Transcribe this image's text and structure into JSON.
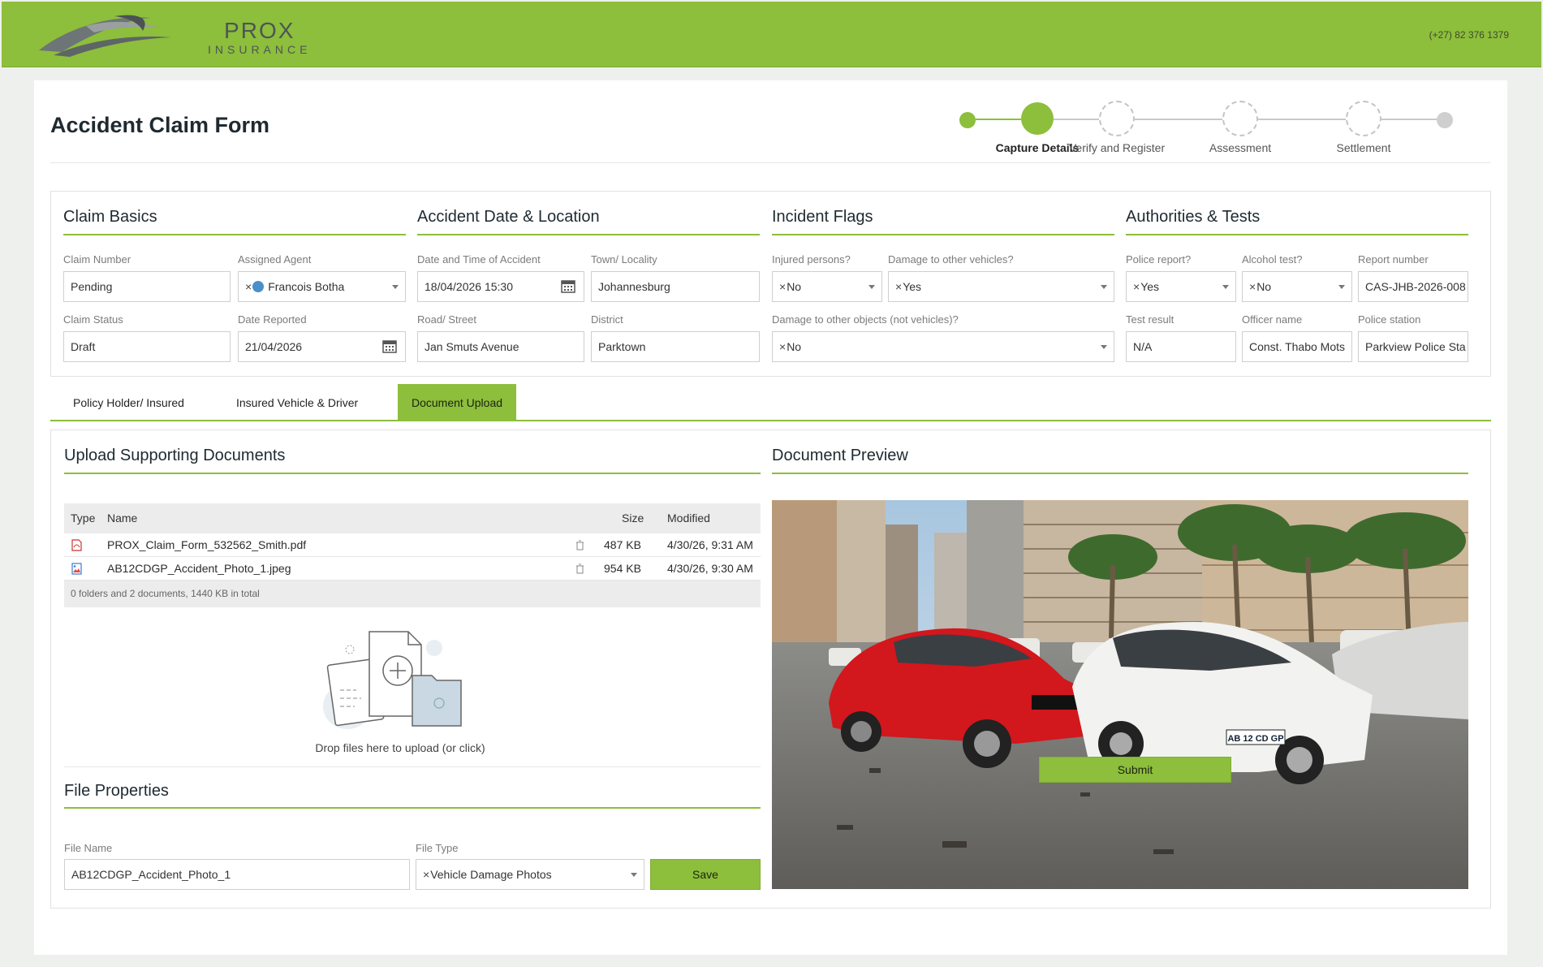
{
  "brand": {
    "name": "PROX",
    "tagline": "INSURANCE",
    "phone": "(+27) 82 376 1379"
  },
  "colors": {
    "accent": "#8dbe3c",
    "header": "#8dbe3c"
  },
  "page_title": "Accident Claim Form",
  "stepper": {
    "steps": [
      {
        "label": "Capture Details",
        "state": "current"
      },
      {
        "label": "Verify and Register",
        "state": "pending"
      },
      {
        "label": "Assessment",
        "state": "pending"
      },
      {
        "label": "Settlement",
        "state": "pending"
      }
    ]
  },
  "sections": {
    "claim_basics": {
      "title": "Claim Basics",
      "claim_number_label": "Claim Number",
      "claim_number": "Pending",
      "assigned_agent_label": "Assigned Agent",
      "assigned_agent": "Francois Botha",
      "claim_status_label": "Claim Status",
      "claim_status": "Draft",
      "date_reported_label": "Date Reported",
      "date_reported": "21/04/2026"
    },
    "accident": {
      "title": "Accident Date & Location",
      "datetime_label": "Date and Time of Accident",
      "datetime": "18/04/2026 15:30",
      "town_label": "Town/ Locality",
      "town": "Johannesburg",
      "road_label": "Road/ Street",
      "road": "Jan Smuts Avenue",
      "district_label": "District",
      "district": "Parktown"
    },
    "incident": {
      "title": "Incident Flags",
      "injured_label": "Injured persons?",
      "injured": "No",
      "damage_vehicles_label": "Damage to other vehicles?",
      "damage_vehicles": "Yes",
      "damage_objects_label": "Damage to other objects (not vehicles)?",
      "damage_objects": "No"
    },
    "authorities": {
      "title": "Authorities & Tests",
      "police_report_label": "Police report?",
      "police_report": "Yes",
      "alcohol_test_label": "Alcohol test?",
      "alcohol_test": "No",
      "report_number_label": "Report number",
      "report_number": "CAS-JHB-2026-008",
      "test_result_label": "Test result",
      "test_result": "N/A",
      "officer_label": "Officer name",
      "officer": "Const. Thabo Mots",
      "station_label": "Police station",
      "station": "Parkview Police Sta"
    }
  },
  "tabs": [
    "Policy Holder/ Insured",
    "Insured Vehicle & Driver",
    "Document Upload"
  ],
  "active_tab": "Document Upload",
  "upload": {
    "title": "Upload Supporting Documents",
    "columns": {
      "type": "Type",
      "name": "Name",
      "size": "Size",
      "modified": "Modified"
    },
    "files": [
      {
        "type": "pdf",
        "name": "PROX_Claim_Form_532562_Smith.pdf",
        "size": "487 KB",
        "modified": "4/30/26, 9:31 AM"
      },
      {
        "type": "image",
        "name": "AB12CDGP_Accident_Photo_1.jpeg",
        "size": "954 KB",
        "modified": "4/30/26, 9:30 AM"
      }
    ],
    "summary": "0 folders and 2 documents, 1440 KB in total",
    "drop_text": "Drop files here to upload (or click)"
  },
  "file_properties": {
    "title": "File Properties",
    "file_name_label": "File Name",
    "file_name": "AB12CDGP_Accident_Photo_1",
    "file_type_label": "File Type",
    "file_type": "Vehicle Damage Photos",
    "save_label": "Save"
  },
  "preview": {
    "title": "Document Preview",
    "plate": "AB 12 CD GP"
  },
  "submit_label": "Submit"
}
